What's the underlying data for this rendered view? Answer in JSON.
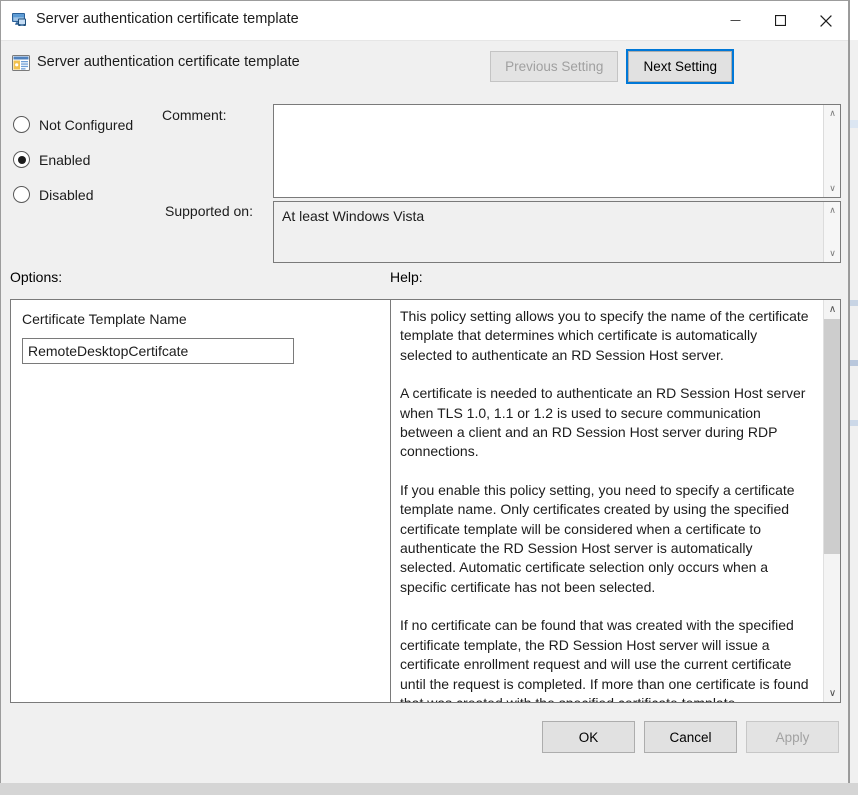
{
  "window": {
    "title": "Server authentication certificate template",
    "title_icon": "remote-desktop-icon",
    "minimize_label": "—",
    "maximize_label": "☐",
    "close_label": "✕"
  },
  "header": {
    "title": "Server authentication certificate template",
    "icon": "group-policy-setting-icon",
    "previous_setting_label": "Previous Setting",
    "next_setting_label": "Next Setting"
  },
  "state": {
    "options": [
      {
        "label": "Not Configured",
        "selected": false
      },
      {
        "label": "Enabled",
        "selected": true
      },
      {
        "label": "Disabled",
        "selected": false
      }
    ],
    "comment_label": "Comment:",
    "comment_value": "",
    "supported_on_label": "Supported on:",
    "supported_on_value": "At least Windows Vista"
  },
  "columns": {
    "options_label": "Options:",
    "help_label": "Help:"
  },
  "options_pane": {
    "field_label": "Certificate Template Name",
    "field_value": "RemoteDesktopCertifcate"
  },
  "help_pane": {
    "paragraphs": [
      "This policy setting allows you to specify the name of the certificate template that determines which certificate is automatically selected to authenticate an RD Session Host server.",
      "A certificate is needed to authenticate an RD Session Host server when TLS 1.0, 1.1 or 1.2 is used to secure communication between a client and an RD Session Host server during RDP connections.",
      "If you enable this policy setting, you need to specify a certificate template name. Only certificates created by using the specified certificate template will be considered when a certificate to authenticate the RD Session Host server is automatically selected. Automatic certificate selection only occurs when a specific certificate has not been selected.",
      "If no certificate can be found that was created with the specified certificate template, the RD Session Host server will issue a certificate enrollment request and will use the current certificate until the request is completed. If more than one certificate is found that was created with the specified certificate template,"
    ],
    "scroll_up_glyph": "∧",
    "scroll_down_glyph": "∨"
  },
  "footer": {
    "ok_label": "OK",
    "cancel_label": "Cancel",
    "apply_label": "Apply"
  },
  "scroll_glyphs": {
    "up": "∧",
    "down": "∨"
  },
  "colors": {
    "accent": "#0078d7",
    "dialog_bg": "#f0f0f0",
    "close_hover": "#e81123"
  }
}
